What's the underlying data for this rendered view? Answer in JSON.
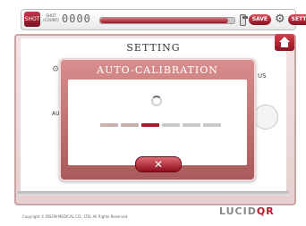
{
  "toolbar": {
    "shot_icon_label": "SHOT",
    "shot_label": "SHOT (COUNT)",
    "shot_count": "0000",
    "progress_fraction": 0.95,
    "save_label": "SAVE",
    "setting_label": "SETTING"
  },
  "page": {
    "title": "SETTING",
    "bg_right_text": "US",
    "bg_left_text": "AU"
  },
  "dialog": {
    "title": "AUTO-CALIBRATION",
    "step_count": 6,
    "active_step": 3,
    "close_label": "✕"
  },
  "footer": {
    "copyright": "Copyright © BISON MEDICAL CO., LTD. All Rights Reserved.",
    "logo_text": "LUCID",
    "logo_accent": "QR"
  },
  "colors": {
    "accent": "#a41c2a",
    "frame": "#e6cfcf"
  },
  "icons": [
    "shot-icon",
    "save-icon",
    "gear-icon",
    "home-icon",
    "spinner-icon",
    "close-icon"
  ]
}
